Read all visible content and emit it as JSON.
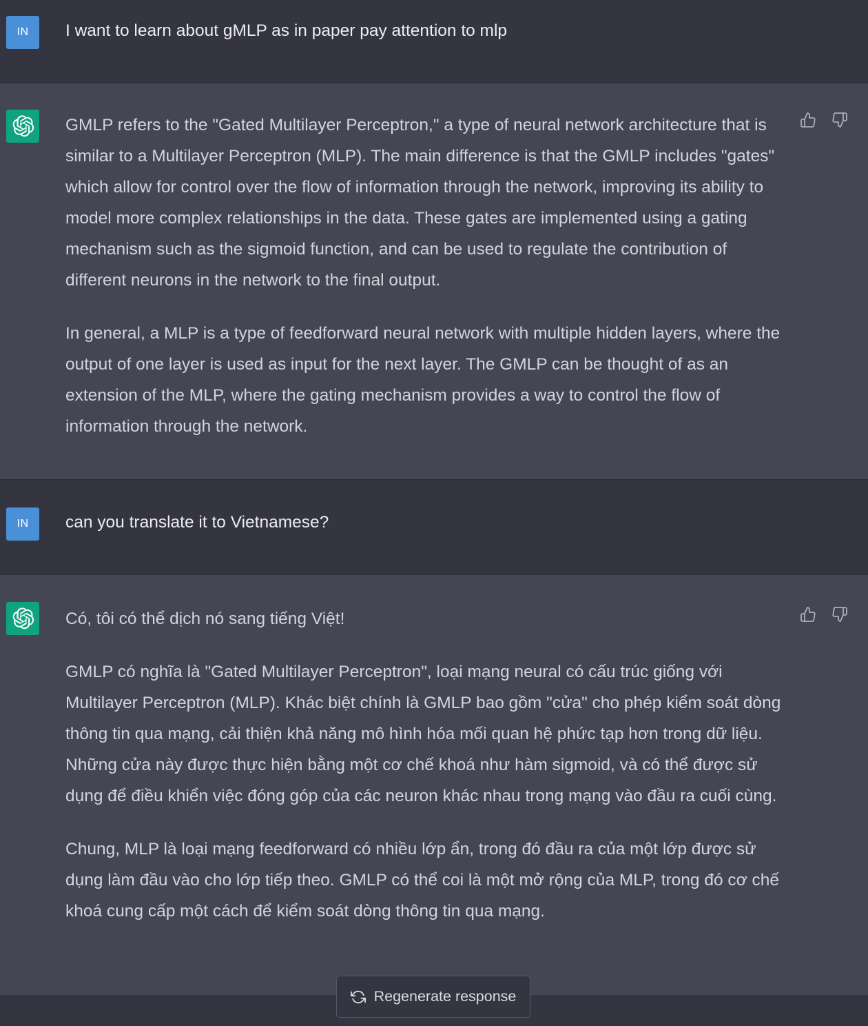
{
  "conversation": {
    "user_initials": "IN",
    "turns": [
      {
        "role": "user",
        "text": "I want to learn about gMLP as in paper pay attention to mlp"
      },
      {
        "role": "assistant",
        "paragraphs": [
          "GMLP refers to the \"Gated Multilayer Perceptron,\" a type of neural network architecture that is similar to a Multilayer Perceptron (MLP). The main difference is that the GMLP includes \"gates\" which allow for control over the flow of information through the network, improving its ability to model more complex relationships in the data. These gates are implemented using a gating mechanism such as the sigmoid function, and can be used to regulate the contribution of different neurons in the network to the final output.",
          "In general, a MLP is a type of feedforward neural network with multiple hidden layers, where the output of one layer is used as input for the next layer. The GMLP can be thought of as an extension of the MLP, where the gating mechanism provides a way to control the flow of information through the network."
        ]
      },
      {
        "role": "user",
        "text": "can you translate it to Vietnamese?"
      },
      {
        "role": "assistant",
        "paragraphs": [
          "Có, tôi có thể dịch nó sang tiếng Việt!",
          "GMLP có nghĩa là \"Gated Multilayer Perceptron\", loại mạng neural có cấu trúc giống với Multilayer Perceptron (MLP). Khác biệt chính là GMLP bao gồm \"cửa\" cho phép kiểm soát dòng thông tin qua mạng, cải thiện khả năng mô hình hóa mối quan hệ phức tạp hơn trong dữ liệu. Những cửa này được thực hiện bằng một cơ chế khoá như hàm sigmoid, và có thể được sử dụng để điều khiển việc đóng góp của các neuron khác nhau trong mạng vào đầu ra cuối cùng.",
          "Chung, MLP là loại mạng feedforward có nhiều lớp ẩn, trong đó đầu ra của một lớp được sử dụng làm đầu vào cho lớp tiếp theo. GMLP có thể coi là một mở rộng của MLP, trong đó cơ chế khoá cung cấp một cách để kiểm soát dòng thông tin qua mạng."
        ]
      }
    ]
  },
  "footer": {
    "regenerate_label": "Regenerate response"
  },
  "icons": {
    "assistant_avatar": "openai-logo-icon",
    "like": "thumbs-up-icon",
    "dislike": "thumbs-down-icon",
    "regenerate": "refresh-icon"
  },
  "colors": {
    "background": "#343541",
    "assistant_background": "#444654",
    "user_avatar": "#4a90d9",
    "assistant_avatar": "#10a37f",
    "text": "#d1d5db"
  }
}
